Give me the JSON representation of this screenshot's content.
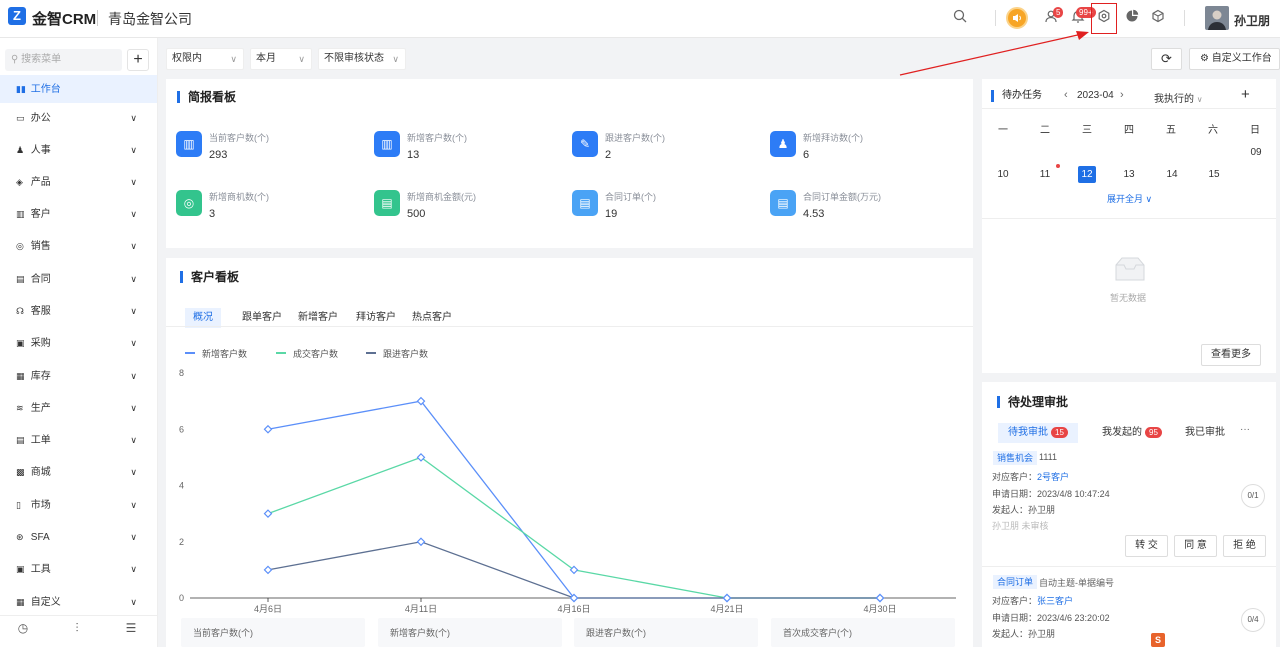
{
  "app": {
    "logo_glyph": "Z",
    "brand": "金智CRM",
    "company": "青岛金智公司",
    "username": "孙卫朋",
    "accent": "#1f6fe5"
  },
  "topbar": {
    "icons": [
      "search-icon",
      "speaker-icon",
      "contacts-icon",
      "bell-icon",
      "settings-icon",
      "pie-chart-icon",
      "cube-icon"
    ],
    "contacts_badge": "5",
    "bell_badge": "99+"
  },
  "sidebar": {
    "search_placeholder": "搜索菜单",
    "add_label": "+",
    "items": [
      {
        "label": "工作台",
        "icon": "▮▮",
        "active": true
      },
      {
        "label": "办公",
        "icon": "▭"
      },
      {
        "label": "人事",
        "icon": "♟"
      },
      {
        "label": "产品",
        "icon": "◈"
      },
      {
        "label": "客户",
        "icon": "▥"
      },
      {
        "label": "销售",
        "icon": "◎"
      },
      {
        "label": "合同",
        "icon": "▤"
      },
      {
        "label": "客服",
        "icon": "☊"
      },
      {
        "label": "采购",
        "icon": "▣"
      },
      {
        "label": "库存",
        "icon": "▦"
      },
      {
        "label": "生产",
        "icon": "≋"
      },
      {
        "label": "工单",
        "icon": "▤"
      },
      {
        "label": "商城",
        "icon": "▩"
      },
      {
        "label": "市场",
        "icon": "▯"
      },
      {
        "label": "SFA",
        "icon": "⊛"
      },
      {
        "label": "工具",
        "icon": "▣"
      },
      {
        "label": "自定义",
        "icon": "▦"
      }
    ],
    "footer_icons": [
      "◷",
      "⫶",
      "☰"
    ]
  },
  "filters": {
    "scope": "权限内",
    "period": "本月",
    "audit": "不限审核状态"
  },
  "toolbar": {
    "refresh_glyph": "⟳",
    "custom_label": "自定义工作台",
    "custom_glyph": "⚙"
  },
  "brief": {
    "title": "简报看板",
    "stats": [
      {
        "label": "当前客户数(个)",
        "value": "293",
        "color": "#2d7cf6",
        "glyph": "▥"
      },
      {
        "label": "新增客户数(个)",
        "value": "13",
        "color": "#2d7cf6",
        "glyph": "▥"
      },
      {
        "label": "跟进客户数(个)",
        "value": "2",
        "color": "#2d7cf6",
        "glyph": "✎"
      },
      {
        "label": "新增拜访数(个)",
        "value": "6",
        "color": "#2d7cf6",
        "glyph": "♟"
      },
      {
        "label": "新增商机数(个)",
        "value": "3",
        "color": "#33c48d",
        "glyph": "◎"
      },
      {
        "label": "新增商机金额(元)",
        "value": "500",
        "color": "#33c48d",
        "glyph": "▤"
      },
      {
        "label": "合同订单(个)",
        "value": "19",
        "color": "#4aa3f5",
        "glyph": "▤"
      },
      {
        "label": "合同订单金额(万元)",
        "value": "4.53",
        "color": "#4aa3f5",
        "glyph": "▤"
      }
    ]
  },
  "customer_board": {
    "title": "客户看板",
    "tabs": [
      "概况",
      "跟单客户",
      "新增客户",
      "拜访客户",
      "热点客户"
    ],
    "summary_cards": [
      "当前客户数(个)",
      "新增客户数(个)",
      "跟进客户数(个)",
      "首次成交客户(个)"
    ]
  },
  "chart_data": {
    "type": "line",
    "categories": [
      "4月6日",
      "4月11日",
      "4月16日",
      "4月21日",
      "4月30日"
    ],
    "series": [
      {
        "name": "新增客户数",
        "values": [
          6,
          7,
          0,
          0,
          0
        ],
        "color": "#5b8ff9"
      },
      {
        "name": "成交客户数",
        "values": [
          3,
          5,
          1,
          0,
          0
        ],
        "color": "#5ad8a6"
      },
      {
        "name": "跟进客户数",
        "values": [
          1,
          2,
          0,
          0,
          0
        ],
        "color": "#5d7092"
      }
    ],
    "ylim": [
      0,
      8
    ],
    "yticks": [
      "0",
      "2",
      "4",
      "6",
      "8"
    ],
    "grid": false,
    "legend": "top-left"
  },
  "tasks": {
    "title": "待办任务",
    "month": "2023-04",
    "prev": "‹",
    "next": "›",
    "filter": "我执行的",
    "add": "+",
    "weekdays": [
      "一",
      "二",
      "三",
      "四",
      "五",
      "六",
      "日"
    ],
    "days_row1": [
      "09"
    ],
    "days_row2": [
      "10",
      "11",
      "12",
      "13",
      "14",
      "15"
    ],
    "expand": "展开全月",
    "empty": "暂无数据",
    "more": "查看更多"
  },
  "approvals": {
    "title": "待处理审批",
    "tabs": [
      {
        "label": "待我审批",
        "badge": "15"
      },
      {
        "label": "我发起的",
        "badge": "95"
      },
      {
        "label": "我已审批",
        "badge": ""
      }
    ],
    "more": "···",
    "item1": {
      "tag": "销售机会",
      "subject": "1111",
      "customer_label": "对应客户：",
      "customer": "2号客户",
      "date_label": "申请日期：",
      "date": "2023/4/8 10:47:24",
      "initiator_label": "发起人：",
      "initiator": "孙卫朋",
      "status": "孙卫朋 未审核",
      "progress": "0/1",
      "actions": [
        "转 交",
        "同 意",
        "拒 绝"
      ]
    },
    "item2": {
      "tag": "合同订单",
      "subject": "自动主题-单据编号",
      "customer_label": "对应客户：",
      "customer": "张三客户",
      "date_label": "申请日期：",
      "date": "2023/4/6 23:20:02",
      "initiator_label": "发起人：",
      "initiator": "孙卫朋",
      "progress": "0/4"
    }
  }
}
